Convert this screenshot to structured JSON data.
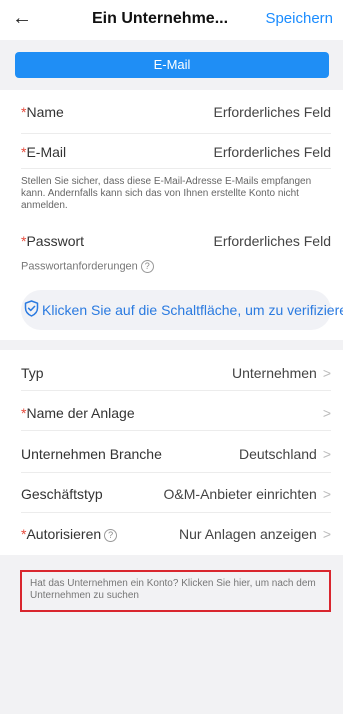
{
  "header": {
    "back_icon": "arrow-left-icon",
    "title": "Ein Unternehme...",
    "save_label": "Speichern"
  },
  "tab": {
    "label": "E-Mail"
  },
  "form": {
    "name": {
      "required": "*",
      "label": "Name",
      "value": "Erforderliches Feld"
    },
    "email": {
      "required": "*",
      "label": "E-Mail",
      "value": "Erforderliches Feld"
    },
    "email_helper": "Stellen Sie sicher, dass diese E-Mail-Adresse E-Mails empfangen kann. Andernfalls kann sich das von Ihnen erstellte Konto nicht anmelden.",
    "password": {
      "required": "*",
      "label": "Passwort",
      "value": "Erforderliches Feld"
    },
    "password_requirements": "Passwortanforderungen",
    "verify_label": "Klicken Sie auf die Schaltfläche, um zu verifizieren"
  },
  "details": {
    "typ": {
      "label": "Typ",
      "value": "Unternehmen"
    },
    "plant_name": {
      "required": "*",
      "label": "Name der Anlage",
      "value": ""
    },
    "branch": {
      "label": "Unternehmen Branche",
      "value": "Deutschland"
    },
    "business_type": {
      "label": "Geschäftstyp",
      "value": "O&M-Anbieter einrichten"
    },
    "authorize": {
      "required": "*",
      "label": "Autorisieren",
      "value": "Nur Anlagen anzeigen"
    }
  },
  "hint": "Hat das Unternehmen ein Konto? Klicken Sie hier, um nach dem Unternehmen zu suchen",
  "colors": {
    "accent": "#1f8ef5",
    "required": "#e64a3b",
    "highlight_border": "#d9262e"
  }
}
